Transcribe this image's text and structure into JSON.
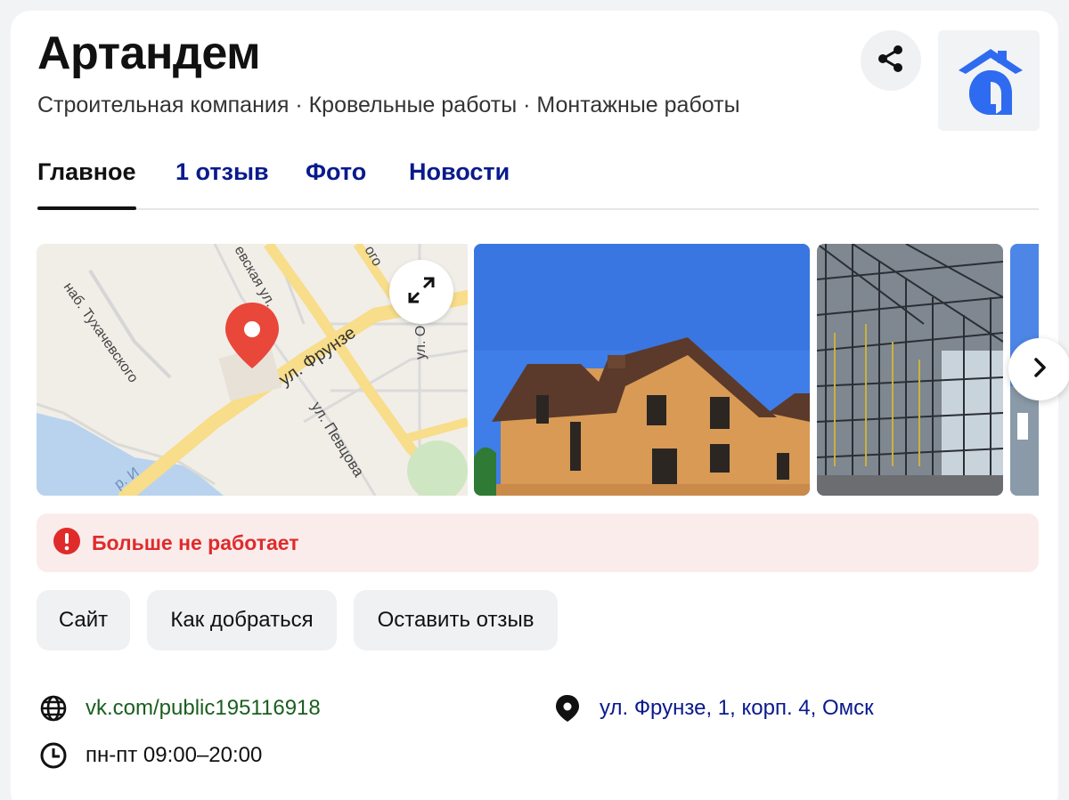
{
  "org": {
    "name": "Артандем",
    "categories": "Строительная компания · Кровельные работы · Монтажные работы"
  },
  "tabs": [
    {
      "label": "Главное"
    },
    {
      "label": "1 отзыв"
    },
    {
      "label": "Фото"
    },
    {
      "label": "Новости"
    }
  ],
  "map": {
    "labels": {
      "street1": "ул. Фрунзе",
      "street2": "ул. Певцова",
      "embankment": "наб. Тухачевского",
      "street3": "евская ул.",
      "street4": "ого",
      "street5": "ул. О",
      "river": "р. И"
    }
  },
  "status": {
    "text": "Больше не работает",
    "color": "#e02b2b"
  },
  "actions": {
    "site": "Сайт",
    "route": "Как добраться",
    "review": "Оставить отзыв"
  },
  "contacts": {
    "website": "vk.com/public195116918",
    "hours": "пн-пт 09:00–20:00",
    "address": "ул. Фрунзе, 1, корп. 4, Омск"
  },
  "colors": {
    "accent": "#0a1a8c",
    "link_green": "#1b5e20",
    "alert_bg": "#fbecec",
    "logo_blue": "#2f6bf0",
    "pin_red": "#e8473a"
  }
}
